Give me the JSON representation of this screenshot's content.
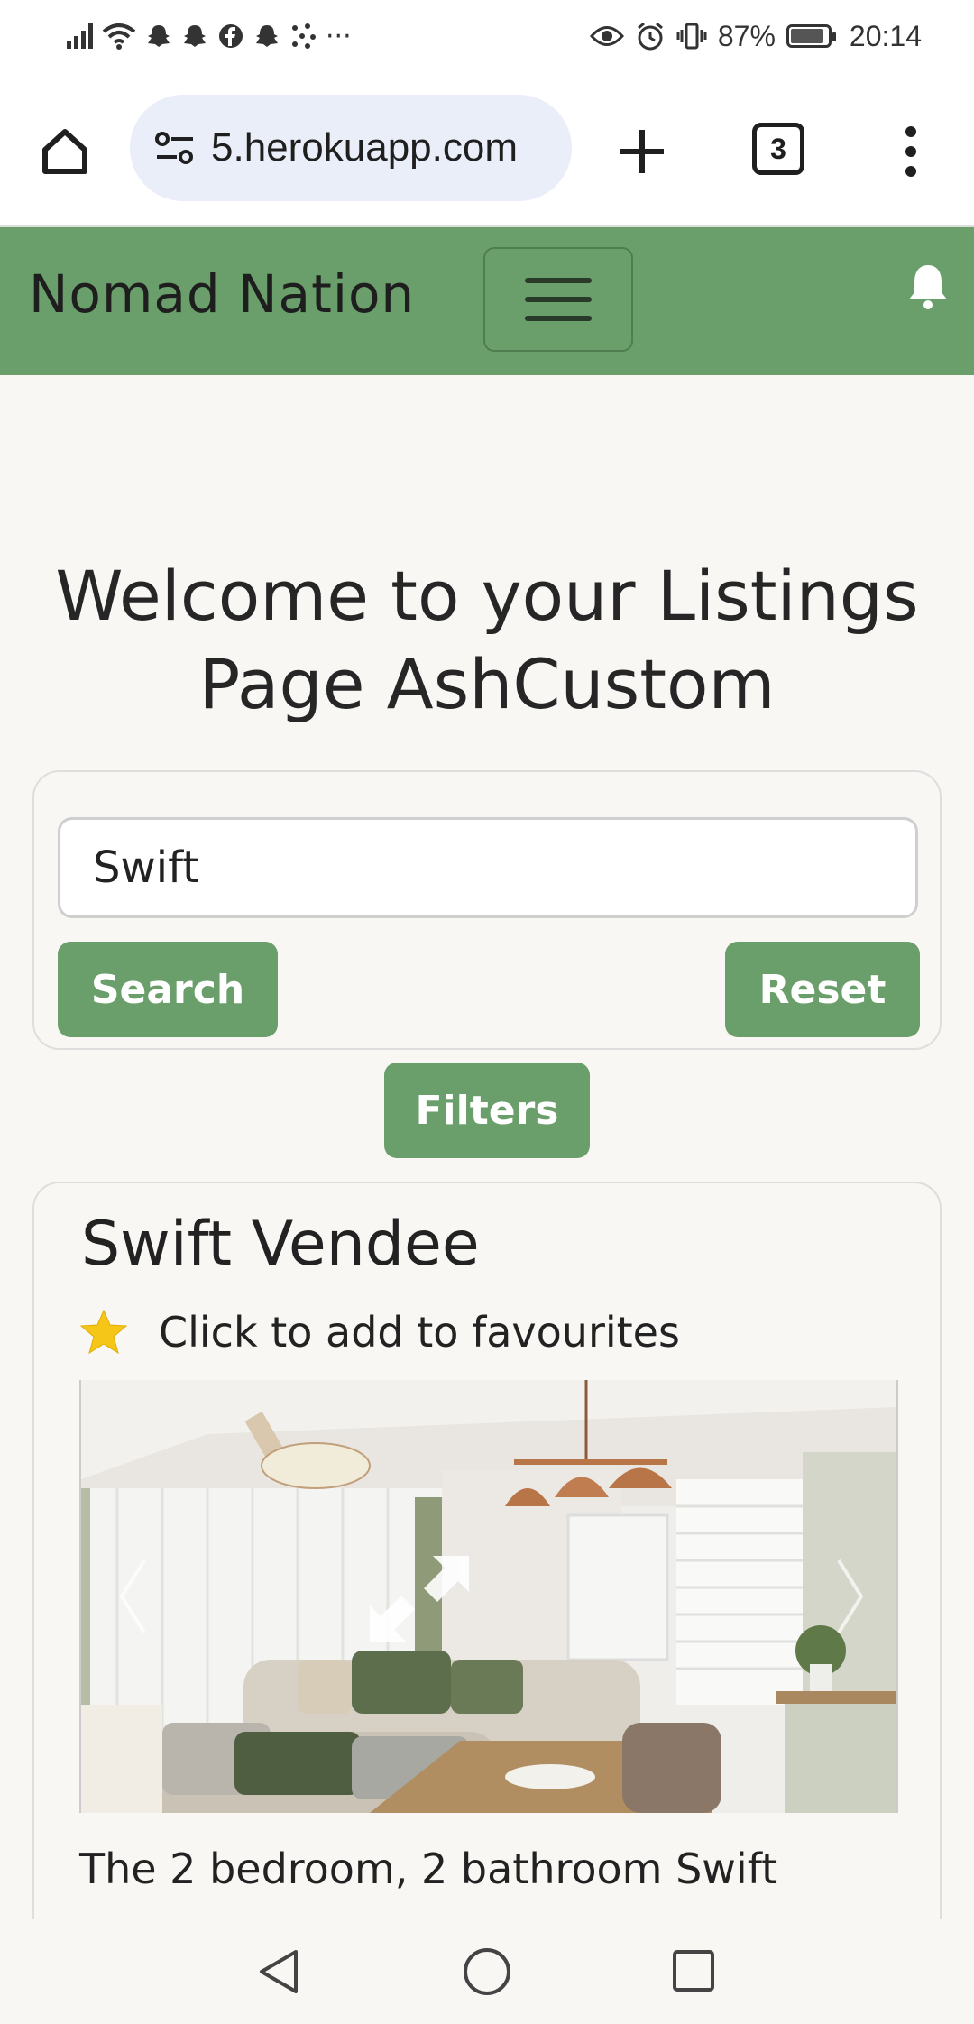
{
  "status_bar": {
    "time": "20:14",
    "battery_percent": "87%",
    "left_icons": [
      "signal-icon",
      "wifi-icon",
      "snapchat-icon",
      "snapchat-icon",
      "facebook-icon",
      "snapchat-icon",
      "dots-icon"
    ],
    "more": "···"
  },
  "browser": {
    "url": "5.herokuapp.com",
    "tab_count": "3"
  },
  "navbar": {
    "brand": "Nomad Nation"
  },
  "page": {
    "welcome_heading": "Welcome to your Listings Page AshCustom",
    "search": {
      "value": "Swift",
      "search_label": "Search",
      "reset_label": "Reset"
    },
    "filters_label": "Filters"
  },
  "listing": {
    "title": "Swift Vendee",
    "favourite_label": "Click to add to favourites",
    "description": "The 2 bedroom, 2 bathroom Swift"
  },
  "colors": {
    "brand_green": "#6a9e6a",
    "favourite_star": "#f5c518"
  }
}
